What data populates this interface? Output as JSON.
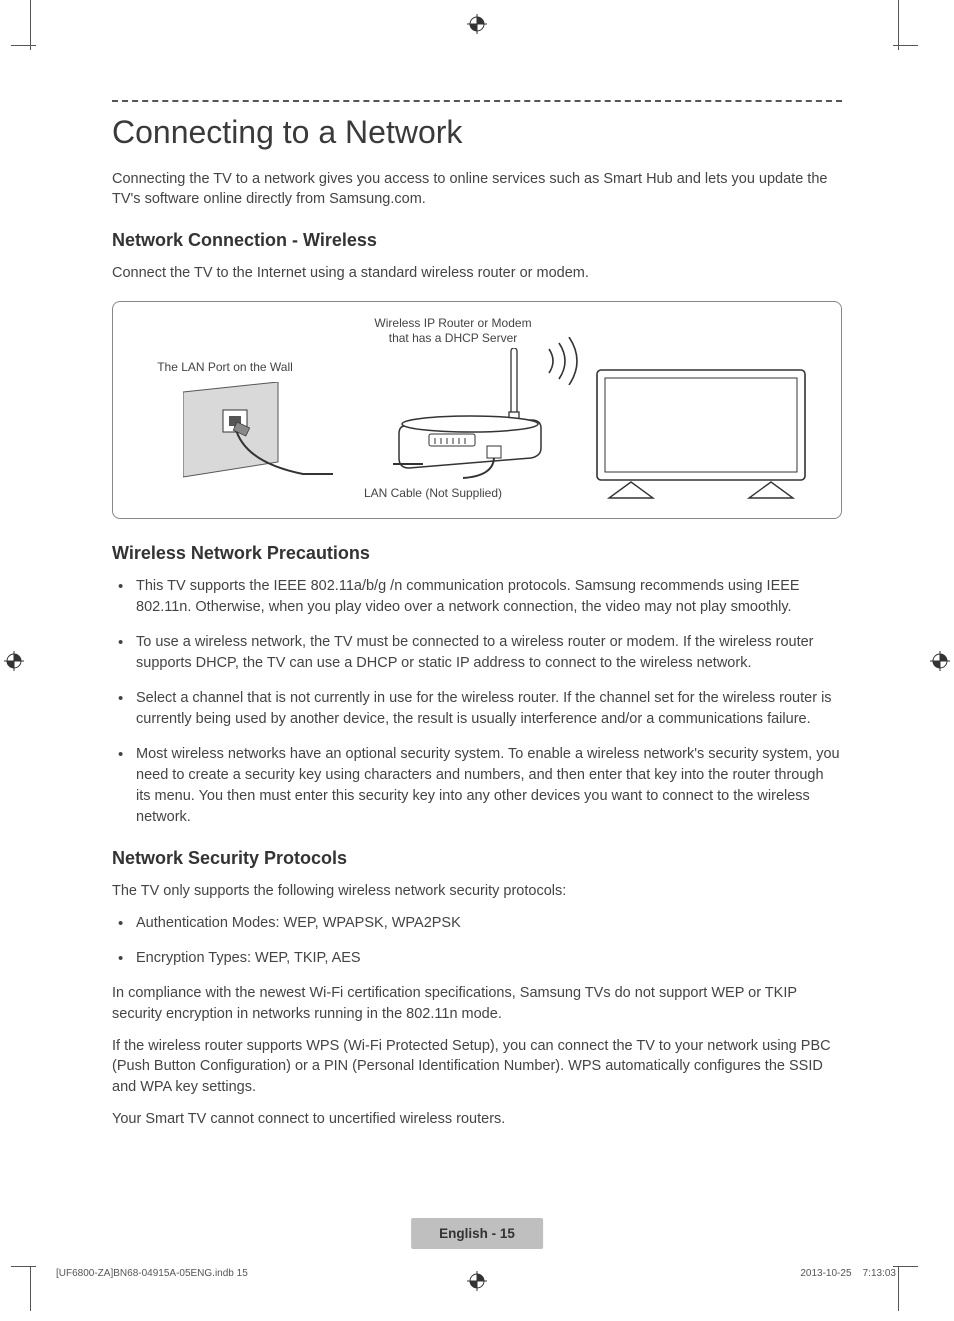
{
  "title": "Connecting to a Network",
  "intro": "Connecting the TV to a network gives you access to online services such as Smart Hub and lets you update the TV's software online directly from Samsung.com.",
  "section_wireless": {
    "heading": "Network Connection - Wireless",
    "body": "Connect the TV to the Internet using a standard wireless router or modem.",
    "diagram": {
      "router_label": "Wireless IP Router or Modem that has a DHCP Server",
      "lan_label": "The LAN Port on the Wall",
      "cable_label": "LAN Cable (Not Supplied)"
    }
  },
  "section_precautions": {
    "heading": "Wireless Network Precautions",
    "bullets": [
      "This TV supports the IEEE 802.11a/b/g /n communication protocols. Samsung recommends using IEEE 802.11n. Otherwise, when you play video over a network connection, the video may not play smoothly.",
      "To use a wireless network, the TV must be connected to a wireless router or modem. If the wireless router supports DHCP, the TV can use a DHCP or static IP address to connect to the wireless network.",
      "Select a channel that is not currently in use for the wireless router. If the channel set for the wireless router is currently being used by another device, the result is usually interference and/or a communications failure.",
      "Most wireless networks have an optional security system. To enable a wireless network's security system, you need to create a security key using characters and numbers, and then enter that key into the router through its menu. You then must enter this security key into any other devices you want to connect to the wireless network."
    ]
  },
  "section_security": {
    "heading": "Network Security Protocols",
    "intro": "The TV only supports the following wireless network security protocols:",
    "bullets": [
      "Authentication Modes: WEP, WPAPSK, WPA2PSK",
      "Encryption Types: WEP, TKIP, AES"
    ],
    "para1": "In compliance with the newest Wi-Fi certification specifications, Samsung TVs do not support WEP or TKIP security encryption in networks running in the 802.11n mode.",
    "para2": "If the wireless router supports WPS (Wi-Fi Protected Setup), you can connect the TV to your network using PBC (Push Button Configuration) or a PIN (Personal Identification Number). WPS automatically configures the SSID and WPA key settings.",
    "para3": "Your Smart TV cannot connect to uncertified wireless routers."
  },
  "footer": {
    "page_label": "English - 15",
    "doc_left": "[UF6800-ZA]BN68-04915A-05ENG.indb   15",
    "doc_right": "2013-10-25      7:13:03"
  }
}
